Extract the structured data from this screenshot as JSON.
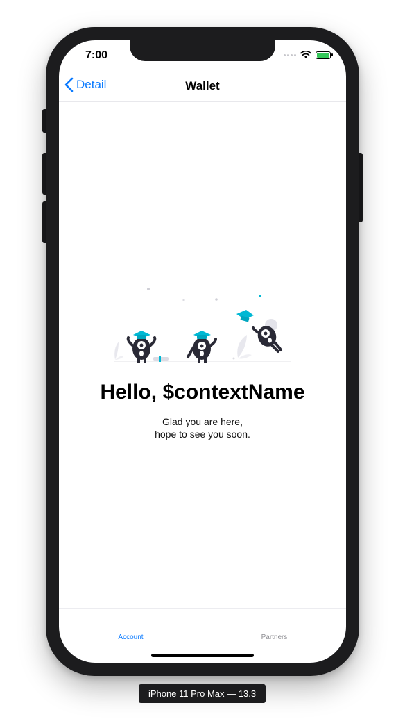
{
  "status": {
    "time": "7:00"
  },
  "nav": {
    "back_label": "Detail",
    "title": "Wallet"
  },
  "content": {
    "greeting": "Hello, $contextName",
    "message_line1": "Glad you are here,",
    "message_line2": "hope to see you soon."
  },
  "tabs": [
    {
      "label": "Account",
      "selected": true
    },
    {
      "label": "Partners",
      "selected": false
    }
  ],
  "device": {
    "label": "iPhone 11 Pro Max — 13.3"
  },
  "colors": {
    "accent": "#0a7aff",
    "teal": "#00b8d4",
    "dark": "#2a2a36"
  }
}
